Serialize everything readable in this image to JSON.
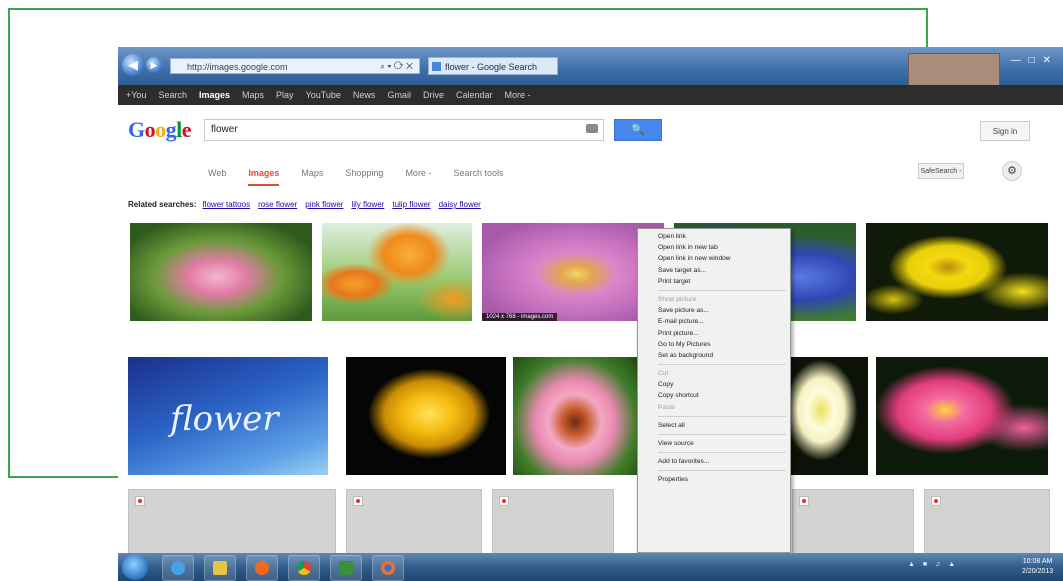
{
  "browser": {
    "address": "http://images.google.com",
    "tab_title": "flower - Google Search",
    "gbar": [
      "+You",
      "Search",
      "Images",
      "Maps",
      "Play",
      "YouTube",
      "News",
      "Gmail",
      "Drive",
      "Calendar",
      "More -"
    ],
    "gbar_active_index": 2
  },
  "search": {
    "logo": "Google",
    "query": "flower",
    "signin": "Sign in",
    "tabs": [
      "Web",
      "Images",
      "Maps",
      "Shopping",
      "More -",
      "Search tools"
    ],
    "active_tab_index": 1,
    "safesearch": "SafeSearch -"
  },
  "related": {
    "label": "Related searches:",
    "items": [
      "flower tattoos",
      "rose flower",
      "pink flower",
      "lily flower",
      "tulip flower",
      "daisy flower"
    ]
  },
  "images": {
    "row1": [
      "pink lotus",
      "orange tulips",
      "pink dahlia",
      "blue flowers",
      "yellow daisies"
    ],
    "row2": [
      "flower artwork",
      "yellow rose",
      "butterfly on flower",
      "white lily",
      "pink plumeria"
    ],
    "caption": "1024 x 768 - images.com"
  },
  "context_menu": [
    {
      "label": "Open link",
      "enabled": true
    },
    {
      "label": "Open link in new tab",
      "enabled": true
    },
    {
      "label": "Open link in new window",
      "enabled": true
    },
    {
      "label": "Save target as...",
      "enabled": true
    },
    {
      "label": "Print target",
      "enabled": true
    },
    {
      "sep": true
    },
    {
      "label": "Show picture",
      "enabled": false
    },
    {
      "label": "Save picture as...",
      "enabled": true
    },
    {
      "label": "E-mail picture...",
      "enabled": true
    },
    {
      "label": "Print picture...",
      "enabled": true
    },
    {
      "label": "Go to My Pictures",
      "enabled": true
    },
    {
      "label": "Set as background",
      "enabled": true
    },
    {
      "sep": true
    },
    {
      "label": "Cut",
      "enabled": false
    },
    {
      "label": "Copy",
      "enabled": true
    },
    {
      "label": "Copy shortcut",
      "enabled": true
    },
    {
      "label": "Paste",
      "enabled": false
    },
    {
      "sep": true
    },
    {
      "label": "Select all",
      "enabled": true
    },
    {
      "sep": true
    },
    {
      "label": "View source",
      "enabled": true
    },
    {
      "sep": true
    },
    {
      "label": "Add to favorites...",
      "enabled": true
    },
    {
      "sep": true
    },
    {
      "label": "Properties",
      "enabled": true
    }
  ],
  "taskbar": {
    "apps": [
      "ie-icon",
      "explorer-icon",
      "media-icon",
      "chrome-icon",
      "app-icon",
      "firefox-icon"
    ],
    "clock_time": "10:08 AM",
    "clock_date": "2/20/2013"
  },
  "colors": {
    "frame": "#3aa64a",
    "google_blue": "#4787ed",
    "active_tab": "#dd4b39",
    "gbar": "#2d2d2d"
  }
}
